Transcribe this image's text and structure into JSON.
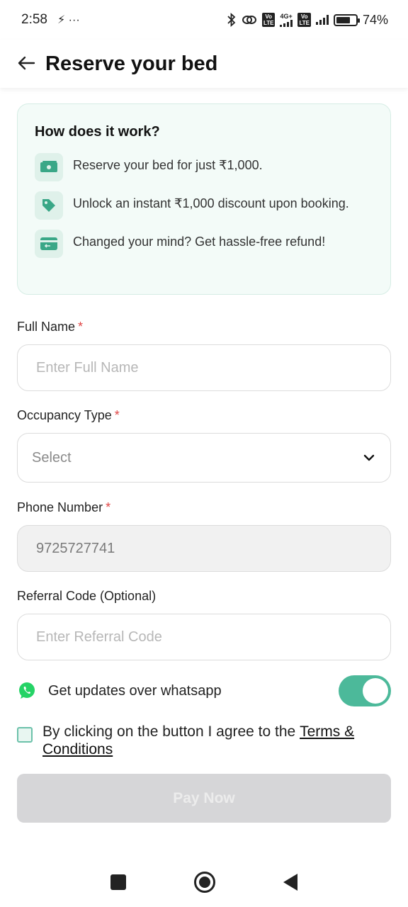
{
  "status_bar": {
    "time": "2:58",
    "notif_icons": "⚡ ···",
    "lte1": "Vo\nLTE",
    "net_label": "4G+",
    "lte2": "Vo\nLTE",
    "battery_percent": "74%",
    "battery_level": 0.74
  },
  "header": {
    "title": "Reserve your bed"
  },
  "how_it_works": {
    "title": "How does it work?",
    "items": [
      {
        "text": "Reserve your bed for just ₹1,000.",
        "icon": "cash-icon"
      },
      {
        "text": "Unlock an instant ₹1,000 discount upon booking.",
        "icon": "tag-icon"
      },
      {
        "text": "Changed your mind? Get hassle-free refund!",
        "icon": "refund-card-icon"
      }
    ]
  },
  "form": {
    "full_name": {
      "label": "Full Name",
      "required_mark": "*",
      "placeholder": "Enter Full Name"
    },
    "occupancy": {
      "label": "Occupancy Type",
      "required_mark": "*",
      "selected": "Select"
    },
    "phone": {
      "label": "Phone Number",
      "required_mark": "*",
      "value": "9725727741"
    },
    "referral": {
      "label": "Referral Code (Optional)",
      "placeholder": "Enter Referral Code"
    }
  },
  "whatsapp": {
    "label": "Get updates over whatsapp",
    "enabled": true
  },
  "terms": {
    "prefix": "By clicking on the button I agree to the ",
    "link": "Terms & Conditions",
    "checked": false
  },
  "pay_button": {
    "label": "Pay Now",
    "enabled": false
  },
  "colors": {
    "accent": "#4cb99a",
    "card_bg": "#f3fbf8",
    "required": "#e04545",
    "disabled_button": "#d6d6d8"
  }
}
